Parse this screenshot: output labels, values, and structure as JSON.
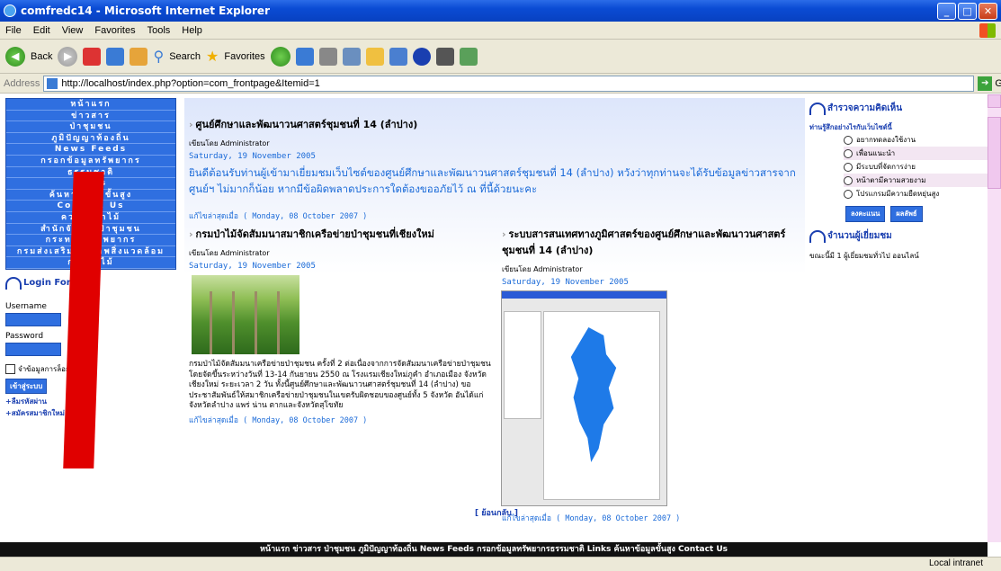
{
  "window": {
    "title": "comfredc14 - Microsoft Internet Explorer"
  },
  "menubar": {
    "items": [
      "File",
      "Edit",
      "View",
      "Favorites",
      "Tools",
      "Help"
    ]
  },
  "toolbar": {
    "back": "Back",
    "search": "Search",
    "favorites": "Favorites"
  },
  "address": {
    "label": "Address",
    "url": "http://localhost/index.php?option=com_frontpage&Itemid=1",
    "go": "Go"
  },
  "nav": {
    "items": [
      "หน้าแรก",
      "ข่าวสาร",
      "ป่าชุมชน",
      "ภูมิปัญญาท้องถิ่น",
      "News Feeds",
      "กรอกข้อมูลทรัพยากร",
      "ธรรมชาติ",
      "Links",
      "ค้นหาข้อมูลขั้นสูง",
      "Contact Us",
      "ความรู้ป่าไม้",
      "สำนักจัดการป่าชุมชน",
      "กระทรวงทรัพยากร",
      "กรมส่งเสริมคุณภาพสิ่งแวดล้อม",
      "กรมป่าไม้"
    ]
  },
  "login": {
    "title": "Login Form",
    "username_label": "Username",
    "password_label": "Password",
    "remember": "จำข้อมูลการล็อกอิน",
    "button": "เข้าสู่ระบบ",
    "forgot": "+ลืมรหัสผ่าน",
    "register": "+สมัครสมาชิกใหม่"
  },
  "main": {
    "article1": {
      "title": "ศูนย์ศึกษาและพัฒนาวนศาสตร์ชุมชนที่ 14 (ลำปาง)",
      "author": "เขียนโดย Administrator",
      "date": "Saturday, 19 November 2005",
      "intro": "ยินดีต้อนรับท่านผู้เข้ามาเยี่ยมชมเว็บไซต์ของศูนย์ศึกษาและพัฒนาวนศาสตร์ชุมชนที่ 14 (ลำปาง) หวังว่าทุกท่านจะได้รับข้อมูลข่าวสารจากศูนย์ฯ ไม่มากก็น้อย หากมีข้อผิดพลาดประการใดต้องขออภัยไว้ ณ ที่นี้ด้วยนะคะ",
      "updated": "แก้ไขล่าสุดเมื่อ ( Monday, 08 October 2007 )"
    },
    "article2": {
      "title": "กรมป่าไม้จัดสัมมนาสมาชิกเครือข่ายป่าชุมชนที่เชียงใหม่",
      "author": "เขียนโดย Administrator",
      "date": "Saturday, 19 November 2005",
      "body": "กรมป่าไม้จัดสัมมนาเครือข่ายป่าชุมชน ครั้งที่ 2 ต่อเนื่องจากการจัดสัมมนาเครือข่ายป่าชุมชน โดยจัดขึ้นระหว่างวันที่ 13-14 กันยายน 2550 ณ โรงแรมเชียงใหม่ภูคำ อำเภอเมือง จังหวัดเชียงใหม่ ระยะเวลา 2 วัน ทั้งนี้ศูนย์ศึกษาและพัฒนาวนศาสตร์ชุมชนที่ 14 (ลำปาง) ขอประชาสัมพันธ์ให้สมาชิกเครือข่ายป่าชุมชนในเขตรับผิดชอบของศูนย์ทั้ง 5 จังหวัด อันได้แก่ จังหวัดลำปาง แพร่ น่าน ตากและจังหวัดสุโขทัย",
      "updated": "แก้ไขล่าสุดเมื่อ ( Monday, 08 October 2007 )"
    },
    "article3": {
      "title": "ระบบสารสนเทศทางภูมิศาสตร์ของศูนย์ศึกษาและพัฒนาวนศาสตร์ชุมชนที่ 14 (ลำปาง)",
      "author": "เขียนโดย Administrator",
      "date": "Saturday, 19 November 2005",
      "updated": "แก้ไขล่าสุดเมื่อ ( Monday, 08 October 2007 )"
    },
    "back": "[ ย้อนกลับ ]"
  },
  "poll": {
    "title": "สำรวจความคิดเห็น",
    "question": "ท่านรู้สึกอย่างไรกับเว็บไซต์นี้",
    "options": [
      "อยากทดลองใช้งาน",
      "เพื่อนแนะนำ",
      "มีระบบที่จัดการง่าย",
      "หน้าตามีความสวยงาม",
      "โปรแกรมมีความยืดหยุ่นสูง"
    ],
    "vote": "ลงคะแนน",
    "results": "ผลลัพธ์"
  },
  "visitors": {
    "title": "จำนวนผู้เยี่ยมชม",
    "text": "ขณะนี้มี 1 ผู้เยี่ยมชมทั่วไป ออนไลน์"
  },
  "footer": {
    "text": "หน้าแรก ข่าวสาร ป่าชุมชน ภูมิปัญญาท้องถิ่น News Feeds กรอกข้อมูลทรัพยากรธรรมชาติ Links ค้นหาข้อมูลขั้นสูง Contact Us"
  },
  "status": {
    "zone": "Local intranet"
  }
}
